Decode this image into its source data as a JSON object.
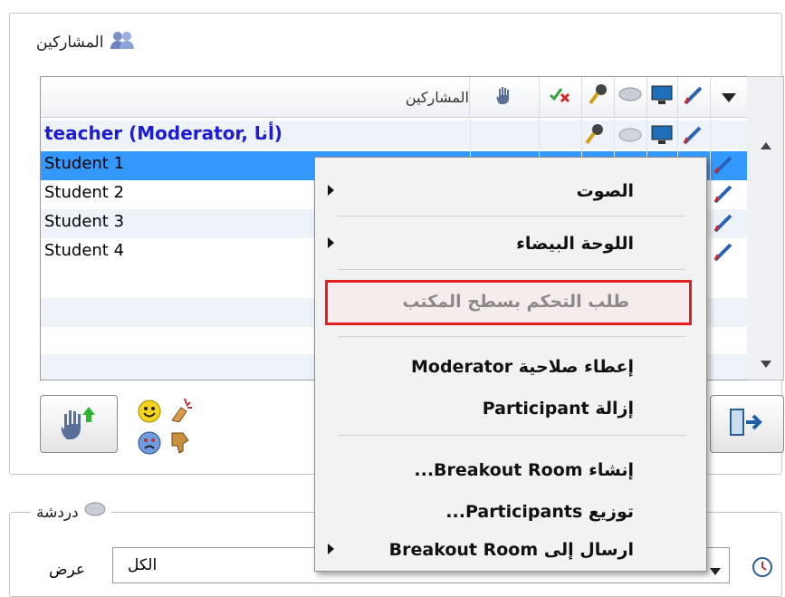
{
  "participants_group": {
    "title": "المشاركين",
    "column_header": "المشاركين",
    "rows": [
      {
        "name": "teacher (Moderator, أنا)"
      },
      {
        "name": "Student 1"
      },
      {
        "name": "Student 2"
      },
      {
        "name": "Student 3"
      },
      {
        "name": "Student 4"
      }
    ]
  },
  "context_menu": {
    "items": [
      {
        "label": "الصوت",
        "submenu": true
      },
      {
        "label": "اللوحة البيضاء",
        "submenu": true
      },
      {
        "label": "طلب التحكم بسطح المكتب",
        "disabled": true,
        "highlighted": true
      },
      {
        "label": "إعطاء صلاحية Moderator"
      },
      {
        "label": "إزالة Participant"
      },
      {
        "label": "إنشاء Breakout Room..."
      },
      {
        "label": "توزيع Participants..."
      },
      {
        "label": "ارسال إلى Breakout Room",
        "submenu": true
      }
    ]
  },
  "chat_group": {
    "title": "دردشة",
    "view_label": "عرض",
    "view_selected": "الكل"
  },
  "colors": {
    "moderator_text": "#1c1cd6",
    "selection": "#3399ff",
    "highlight_border": "#e02020",
    "alt_row": "#eef2f9"
  }
}
